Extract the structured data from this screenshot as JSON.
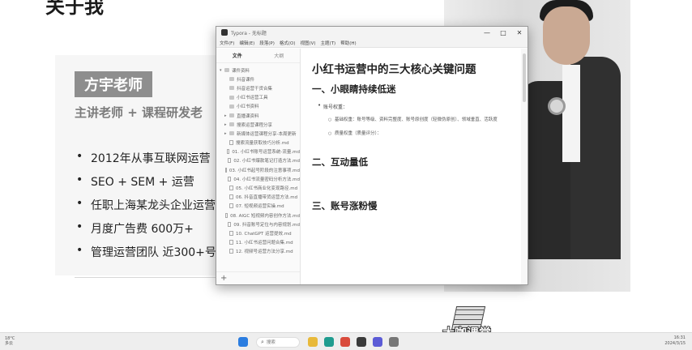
{
  "slide": {
    "heading": "关于我",
    "name_badge": "方宇老师",
    "subtitle": "主讲老师 + 课程研发老",
    "bullets": [
      "2012年从事互联网运营",
      "SEO + SEM + 运营",
      "任职上海某龙头企业运营",
      "月度广告费 600万+",
      "管理运营团队 近300+号"
    ]
  },
  "window": {
    "app_name": "Typora",
    "title": "Typora - 无标题",
    "menu": [
      "文件(F)",
      "编辑(E)",
      "段落(P)",
      "格式(O)",
      "视图(V)",
      "主题(T)",
      "帮助(H)"
    ],
    "controls": [
      "—",
      "□",
      "✕"
    ],
    "sidebar_tabs": [
      "文件",
      "大纲"
    ],
    "file_tree": [
      {
        "type": "folder-open",
        "label": "课件资料"
      },
      {
        "type": "folder",
        "label": "抖音课件"
      },
      {
        "type": "folder",
        "label": "抖音运营干货合集"
      },
      {
        "type": "folder",
        "label": "小红书运营工具"
      },
      {
        "type": "folder",
        "label": "小红书资料"
      },
      {
        "type": "folder-closed",
        "label": "直播课资料"
      },
      {
        "type": "folder-closed",
        "label": "搜索运营课程分享"
      },
      {
        "type": "folder-closed",
        "label": "新媒体运营课程分享-本周更新"
      },
      {
        "type": "doc",
        "label": "搜索流量获取技巧分析.md"
      },
      {
        "type": "doc",
        "label": "01. 小红书账号运营系统-流量.md"
      },
      {
        "type": "doc",
        "label": "02. 小红书爆款笔记打造方法.md"
      },
      {
        "type": "doc",
        "label": "03. 小红书起号阶段的注意事项.md"
      },
      {
        "type": "doc",
        "label": "04. 小红书流量密码分析方法.md"
      },
      {
        "type": "doc",
        "label": "05. 小红书商业化变现路径.md"
      },
      {
        "type": "doc",
        "label": "06. 抖音直播带货运营方法.md"
      },
      {
        "type": "doc",
        "label": "07. 短视频运营实操.md"
      },
      {
        "type": "doc",
        "label": "08. AIGC 短视频内容创作方法.md"
      },
      {
        "type": "doc",
        "label": "09. 抖音账号定位与内容规划.md"
      },
      {
        "type": "doc",
        "label": "10. ChatGPT 运营提效.md"
      },
      {
        "type": "doc",
        "label": "11. 小红书运营问题合集.md"
      },
      {
        "type": "doc",
        "label": "12. 视频号运营方法分享.md"
      }
    ],
    "doc": {
      "title": "小红书运营中的三大核心关键问题",
      "sections": [
        {
          "heading": "一、小眼睛持续低迷",
          "bullet": "账号权重：",
          "subs": [
            "基础权重：账号等级、资料完整度、账号原创度（轻微伪原创）、领域垂直、活跃度",
            "质量权重（质量评分）："
          ]
        },
        {
          "heading": "二、互动量低"
        },
        {
          "heading": "三、账号涨粉慢"
        }
      ]
    }
  },
  "logo": {
    "text": "大咖课堂"
  },
  "taskbar": {
    "weather_line1": "18°C",
    "weather_line2": "多云",
    "search_placeholder": "搜索",
    "time": "16:31",
    "date": "2024/3/15",
    "icons": [
      {
        "name": "windows-start-icon",
        "color": "#2b7de0"
      },
      {
        "name": "file-explorer-icon",
        "color": "#e8b93a"
      },
      {
        "name": "edge-browser-icon",
        "color": "#1f9c8f"
      },
      {
        "name": "chrome-browser-icon",
        "color": "#d94b3c"
      },
      {
        "name": "typora-icon",
        "color": "#3a3a3a"
      },
      {
        "name": "video-app-icon",
        "color": "#5b5bd6"
      },
      {
        "name": "media-player-icon",
        "color": "#777777"
      }
    ]
  }
}
